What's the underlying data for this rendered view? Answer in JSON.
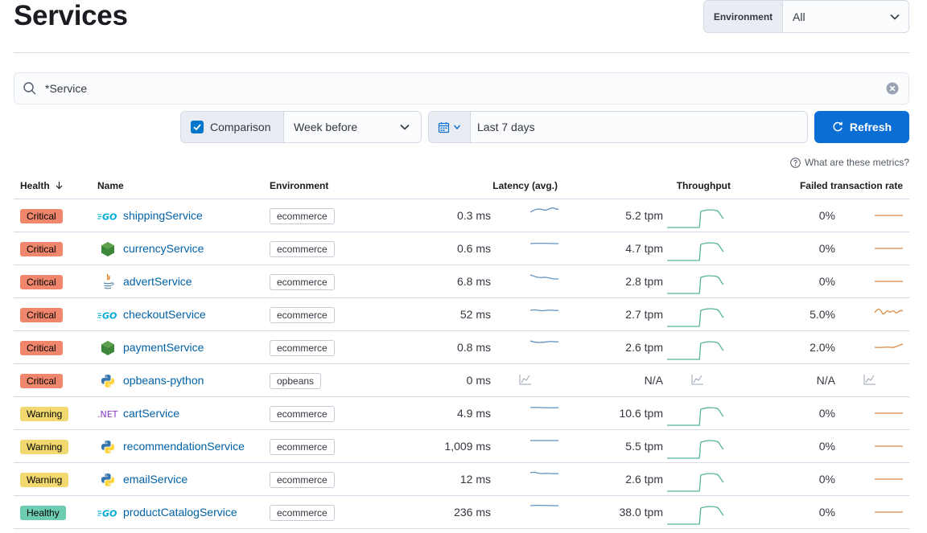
{
  "page": {
    "title": "Services"
  },
  "environment_filter": {
    "label": "Environment",
    "value": "All"
  },
  "search": {
    "value": "*Service"
  },
  "comparison": {
    "label": "Comparison",
    "checked": true,
    "value": "Week before"
  },
  "date_picker": {
    "value": "Last 7 days"
  },
  "refresh": {
    "label": "Refresh"
  },
  "metrics_help": {
    "label": "What are these metrics?"
  },
  "table": {
    "headers": {
      "health": "Health",
      "name": "Name",
      "environment": "Environment",
      "latency": "Latency (avg.)",
      "throughput": "Throughput",
      "failed": "Failed transaction rate"
    },
    "rows": [
      {
        "health": "Critical",
        "icon": "go-icon",
        "name": "shippingService",
        "environment": "ecommerce",
        "latency": "0.3 ms",
        "throughput": "5.2 tpm",
        "failed": "0%"
      },
      {
        "health": "Critical",
        "icon": "nodejs-icon",
        "name": "currencyService",
        "environment": "ecommerce",
        "latency": "0.6 ms",
        "throughput": "4.7 tpm",
        "failed": "0%"
      },
      {
        "health": "Critical",
        "icon": "java-icon",
        "name": "advertService",
        "environment": "ecommerce",
        "latency": "6.8 ms",
        "throughput": "2.8 tpm",
        "failed": "0%"
      },
      {
        "health": "Critical",
        "icon": "go-icon",
        "name": "checkoutService",
        "environment": "ecommerce",
        "latency": "52 ms",
        "throughput": "2.7 tpm",
        "failed": "5.0%"
      },
      {
        "health": "Critical",
        "icon": "nodejs-icon",
        "name": "paymentService",
        "environment": "ecommerce",
        "latency": "0.8 ms",
        "throughput": "2.6 tpm",
        "failed": "2.0%"
      },
      {
        "health": "Critical",
        "icon": "python-icon",
        "name": "opbeans-python",
        "environment": "opbeans",
        "latency": "0 ms",
        "throughput": "N/A",
        "failed": "N/A"
      },
      {
        "health": "Warning",
        "icon": "dotnet-icon",
        "name": "cartService",
        "environment": "ecommerce",
        "latency": "4.9 ms",
        "throughput": "10.6 tpm",
        "failed": "0%"
      },
      {
        "health": "Warning",
        "icon": "python-icon",
        "name": "recommendationService",
        "environment": "ecommerce",
        "latency": "1,009 ms",
        "throughput": "5.5 tpm",
        "failed": "0%"
      },
      {
        "health": "Warning",
        "icon": "python-icon",
        "name": "emailService",
        "environment": "ecommerce",
        "latency": "12 ms",
        "throughput": "2.6 tpm",
        "failed": "0%"
      },
      {
        "health": "Healthy",
        "icon": "go-icon",
        "name": "productCatalogService",
        "environment": "ecommerce",
        "latency": "236 ms",
        "throughput": "38.0 tpm",
        "failed": "0%"
      }
    ]
  },
  "colors": {
    "critical": "#f0866b",
    "warning": "#f1d86f",
    "healthy": "#6dccb1",
    "latency_spark": "#6092c0",
    "throughput_spark": "#54b399",
    "failed_spark": "#da8b45",
    "link": "#0061a6",
    "primary": "#0b6ed4"
  }
}
